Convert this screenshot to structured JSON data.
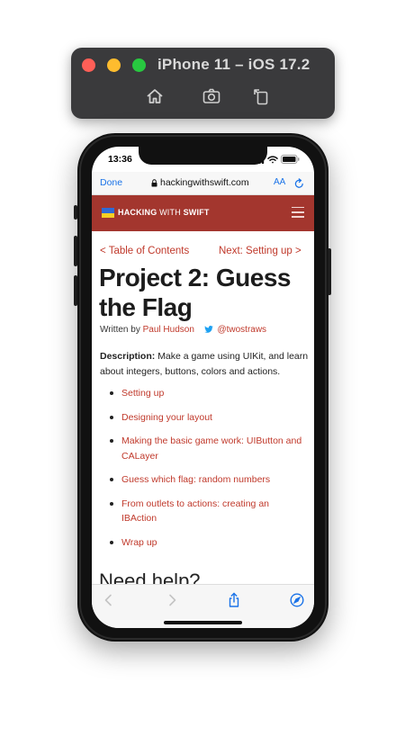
{
  "simulator": {
    "title": "iPhone 11 – iOS 17.2",
    "buttons": [
      "home-icon",
      "screenshot-icon",
      "rotate-icon"
    ]
  },
  "status_bar": {
    "time": "13:36"
  },
  "address_bar": {
    "done": "Done",
    "url": "hackingwithswift.com",
    "text_size": "AA"
  },
  "site_header": {
    "brand_part1": "HACKING",
    "brand_part2": "WITH",
    "brand_part3": "SWIFT",
    "colors": {
      "bar": "#a3362e",
      "flag_blue": "#2f6bd6",
      "flag_yellow": "#f5cf24"
    }
  },
  "article": {
    "prev_link": "< Table of Contents",
    "next_link": "Next: Setting up >",
    "title": "Project 2: Guess the Flag",
    "written_by": "Written by",
    "author": "Paul Hudson",
    "twitter": "@twostraws",
    "description_label": "Description:",
    "description": "Make a game using UIKit, and learn about integers, buttons, colors and actions.",
    "toc": [
      "Setting up",
      "Designing your layout",
      "Making the basic game work: UIButton and CALayer",
      "Guess which flag: random numbers",
      "From outlets to actions: creating an IBAction",
      "Wrap up"
    ],
    "help_heading": "Need help?"
  },
  "accent": "#c0392b"
}
